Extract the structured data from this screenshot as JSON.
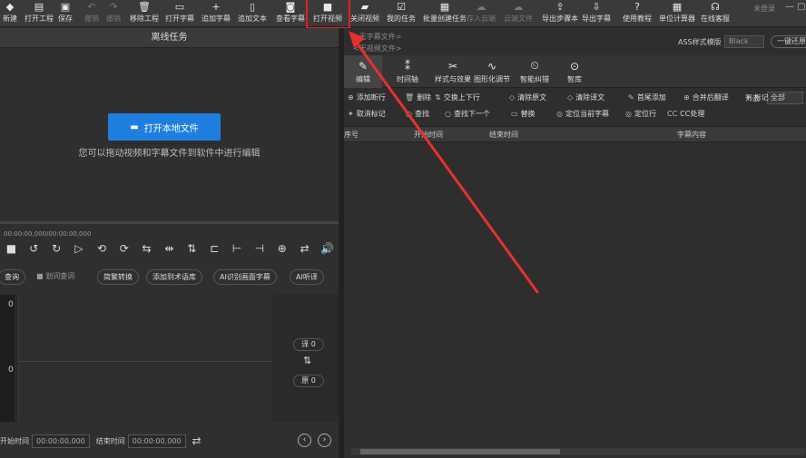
{
  "toolbar": {
    "items": [
      {
        "icon": "new-icon",
        "glyph": "◆",
        "label": "新建",
        "enabled": true
      },
      {
        "icon": "open-project-icon",
        "glyph": "▤",
        "label": "打开工程",
        "enabled": true
      },
      {
        "icon": "save-icon",
        "glyph": "▣",
        "label": "保存",
        "enabled": true
      },
      {
        "icon": "undo-icon",
        "glyph": "↶",
        "label": "撤销",
        "enabled": false
      },
      {
        "icon": "redo-icon",
        "glyph": "↷",
        "label": "撤销",
        "enabled": false
      },
      {
        "icon": "remove-project-icon",
        "glyph": "🗑",
        "label": "移除工程",
        "enabled": true
      },
      {
        "icon": "open-subtitle-icon",
        "glyph": "▭",
        "label": "打开字幕",
        "enabled": true
      },
      {
        "icon": "add-subtitle-icon",
        "glyph": "+",
        "label": "追加字幕",
        "enabled": true
      },
      {
        "icon": "add-text-icon",
        "glyph": "▯",
        "label": "追加文本",
        "enabled": true
      },
      {
        "icon": "view-subtitle-icon",
        "glyph": "◙",
        "label": "查看字幕",
        "enabled": true
      },
      {
        "icon": "open-video-icon",
        "glyph": "■",
        "label": "打开视频",
        "enabled": true
      },
      {
        "icon": "close-video-icon",
        "glyph": "▰",
        "label": "关闭视频",
        "enabled": true
      },
      {
        "icon": "my-tasks-icon",
        "glyph": "☑",
        "label": "我的任务",
        "enabled": true
      },
      {
        "icon": "batch-task-icon",
        "glyph": "▦",
        "label": "批量创建任务",
        "enabled": true
      },
      {
        "icon": "save-cloud-icon",
        "glyph": "☁",
        "label": "存入云端",
        "enabled": false
      },
      {
        "icon": "cloud-file-icon",
        "glyph": "☁",
        "label": "云端文件",
        "enabled": false
      },
      {
        "icon": "export-draft-icon",
        "glyph": "⇪",
        "label": "导出步骤本",
        "enabled": true
      },
      {
        "icon": "export-subtitle-icon",
        "glyph": "⇩",
        "label": "导出字幕",
        "enabled": true
      },
      {
        "icon": "tutorial-icon",
        "glyph": "?",
        "label": "使用教程",
        "enabled": true
      },
      {
        "icon": "calculator-icon",
        "glyph": "▦",
        "label": "单位计算器",
        "enabled": true
      },
      {
        "icon": "support-icon",
        "glyph": "☊",
        "label": "在线客服",
        "enabled": true
      }
    ],
    "login": "未登录",
    "minimize": "—",
    "maximize": "▢"
  },
  "left_panel": {
    "title": "离线任务",
    "open_button": "打开本地文件",
    "hint": "您可以拖动视频和字幕文件到软件中进行编辑",
    "timecode": "00:00:00,000/00:00:00,000",
    "controls": [
      "■",
      "↺",
      "↻",
      "▷",
      "⟲",
      "⟳",
      "⇆",
      "⇹",
      "⇅",
      "⊏",
      "⊢",
      "⊣",
      "⊕",
      "⇄",
      "🔊"
    ],
    "buttons": [
      {
        "label": "查询",
        "plain": false
      },
      {
        "label": "■ 划词查词",
        "plain": true
      },
      {
        "label": "简繁转换",
        "plain": false
      },
      {
        "label": "添加到术语库",
        "plain": false
      },
      {
        "label": "AI识别画面字幕",
        "plain": false
      },
      {
        "label": "AI听译",
        "plain": false
      }
    ],
    "row_numbers": [
      "0",
      "0"
    ],
    "translation_count": "译 0",
    "original_count": "原 0",
    "swap_glyph": "⇅",
    "start_label": "开始时间",
    "start_value": "00:00:00,000",
    "end_label": "结束时间",
    "end_value": "00:00:00,000",
    "repeat_glyph": "⇄",
    "prev_glyph": "‹",
    "next_glyph": "›"
  },
  "right_panel": {
    "subtitle_file": "<无字幕文件>",
    "video_file": "<无视频文件>",
    "ass_label": "ASS样式模版",
    "ass_value": "Black",
    "reset_button": "一键还原",
    "tabs": [
      {
        "icon": "edit-icon",
        "glyph": "✎",
        "label": "编辑",
        "active": true
      },
      {
        "icon": "timeline-icon",
        "glyph": "⁑",
        "label": "时间轴",
        "active": false
      },
      {
        "icon": "style-icon",
        "glyph": "✂",
        "label": "样式与效果",
        "active": false
      },
      {
        "icon": "waveform-icon",
        "glyph": "∿",
        "label": "图形化调节",
        "active": false
      },
      {
        "icon": "timer-icon",
        "glyph": "⏲",
        "label": "智能纠错",
        "active": false
      },
      {
        "icon": "library-icon",
        "glyph": "⊙",
        "label": "智库",
        "active": false
      }
    ],
    "filter_label": "筛选",
    "filter_value": "全部",
    "actions_row1": [
      {
        "glyph": "⊕",
        "label": "添加断行"
      },
      {
        "glyph": "🗑",
        "label": "删除"
      },
      {
        "glyph": "⇅",
        "label": "交换上下行"
      },
      {
        "glyph": "◇",
        "label": "清除原文"
      },
      {
        "glyph": "◇",
        "label": "清除译文"
      },
      {
        "glyph": "✎",
        "label": "首尾添加"
      },
      {
        "glyph": "⊕",
        "label": "合并后翻译"
      },
      {
        "glyph": "✦",
        "label": "标记"
      }
    ],
    "actions_row2": [
      {
        "glyph": "✦",
        "label": "取消标记"
      },
      {
        "glyph": "○",
        "label": "查找"
      },
      {
        "glyph": "○",
        "label": "查找下一个"
      },
      {
        "glyph": "▭",
        "label": "替换"
      },
      {
        "glyph": "◎",
        "label": "定位当前字幕"
      },
      {
        "glyph": "◎",
        "label": "定位行"
      },
      {
        "glyph": "CC",
        "label": "CC处理"
      }
    ],
    "columns": [
      "序号",
      "开始时间",
      "结束时间",
      "字幕内容"
    ]
  },
  "colors": {
    "accent": "#1f7fe0",
    "highlight": "#e02020"
  }
}
